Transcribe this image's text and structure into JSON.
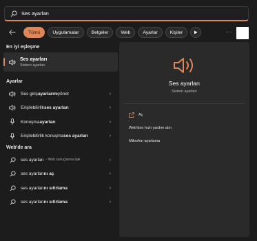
{
  "search": {
    "query": "Ses ayarları"
  },
  "filters": [
    "Tümü",
    "Uygulamalar",
    "Belgeler",
    "Web",
    "Ayarlar",
    "Kişiler"
  ],
  "more_label": "···",
  "left": {
    "best_heading": "En iyi eşleşme",
    "best": {
      "title": "Ses ayarları",
      "subtitle": "Sistem ayarları"
    },
    "settings_heading": "Ayarlar",
    "settings": [
      {
        "pre": "Ses giriş ",
        "bold": "ayarlarını",
        "post": " yönet"
      },
      {
        "pre": "Erişilebilirlik ",
        "bold": "ses ayarları",
        "post": ""
      },
      {
        "pre": "Konuşma ",
        "bold": "ayarları",
        "post": ""
      },
      {
        "pre": "Erişilebilirlik konuşma ",
        "bold": "ses ayarları",
        "post": ""
      }
    ],
    "web_heading": "Web'de ara",
    "web": [
      {
        "pre": "ses ayarları",
        "bold": "",
        "post": "",
        "sub": "- Web sonuçlarına bak"
      },
      {
        "pre": "ses ayarları",
        "bold": "nı aç",
        "post": "",
        "sub": ""
      },
      {
        "pre": "ses ayarları",
        "bold": "nı sıfırlama",
        "post": "",
        "sub": ""
      },
      {
        "pre": "ses ayarları",
        "bold": "nı sıfırlama",
        "post": "",
        "sub": ""
      }
    ]
  },
  "right": {
    "title": "Ses ayarları",
    "subtitle": "Sistem ayarları",
    "actions": [
      "Aç",
      "Web'den hızlı yardım alın",
      "Mikrofon ayarlama"
    ]
  },
  "colors": {
    "accent": "#e0875a"
  }
}
